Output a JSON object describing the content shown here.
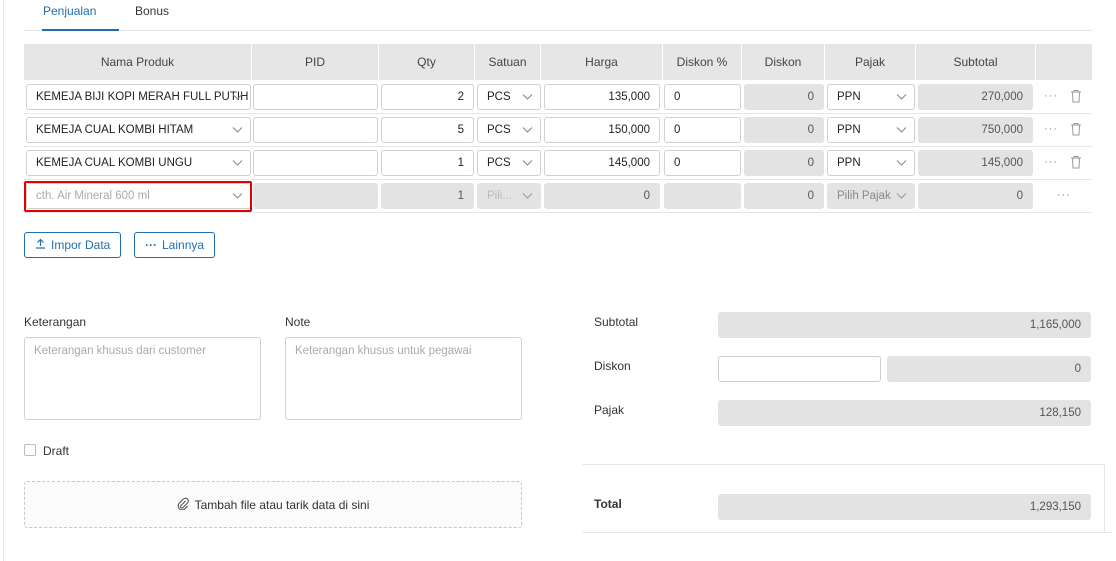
{
  "tabs": [
    {
      "label": "Penjualan",
      "active": true
    },
    {
      "label": "Bonus",
      "active": false
    }
  ],
  "columns": [
    "Nama Produk",
    "PID",
    "Qty",
    "Satuan",
    "Harga",
    "Diskon %",
    "Diskon",
    "Pajak",
    "Subtotal"
  ],
  "rows": [
    {
      "product": "KEMEJA BIJI KOPI MERAH FULL PUTIH",
      "pid": "",
      "qty": "2",
      "unit": "PCS",
      "price": "135,000",
      "disc_pct": "0",
      "disc": "0",
      "tax": "PPN",
      "subtotal": "270,000"
    },
    {
      "product": "KEMEJA CUAL KOMBI HITAM",
      "pid": "",
      "qty": "5",
      "unit": "PCS",
      "price": "150,000",
      "disc_pct": "0",
      "disc": "0",
      "tax": "PPN",
      "subtotal": "750,000"
    },
    {
      "product": "KEMEJA CUAL KOMBI UNGU",
      "pid": "",
      "qty": "1",
      "unit": "PCS",
      "price": "145,000",
      "disc_pct": "0",
      "disc": "0",
      "tax": "PPN",
      "subtotal": "145,000"
    }
  ],
  "new_row": {
    "product_placeholder": "cth. Air Mineral 600 ml",
    "qty": "1",
    "unit_placeholder": "Pili...",
    "price": "0",
    "disc": "0",
    "tax_placeholder": "Pilih Pajak",
    "subtotal": "0"
  },
  "row_menu_glyph": "···",
  "buttons": {
    "import": "Impor Data",
    "more": "Lainnya"
  },
  "keterangan": {
    "label": "Keterangan",
    "placeholder": "Keterangan khusus dari customer"
  },
  "note": {
    "label": "Note",
    "placeholder": "Keterangan khusus untuk pegawai"
  },
  "draft_label": "Draft",
  "upload_label": "Tambah file atau tarik data di sini",
  "summary": {
    "subtotal_label": "Subtotal",
    "subtotal": "1,165,000",
    "discount_label": "Diskon",
    "discount_input": "",
    "discount": "0",
    "tax_label": "Pajak",
    "tax": "128,150",
    "total_label": "Total",
    "total": "1,293,150"
  },
  "colors": {
    "accent": "#1f6fb0",
    "highlight": "#e00000",
    "field_grey": "#e3e3e3"
  },
  "icons": [
    "chevron-down-icon",
    "more-icon",
    "trash-icon",
    "upload-icon",
    "paperclip-icon"
  ]
}
